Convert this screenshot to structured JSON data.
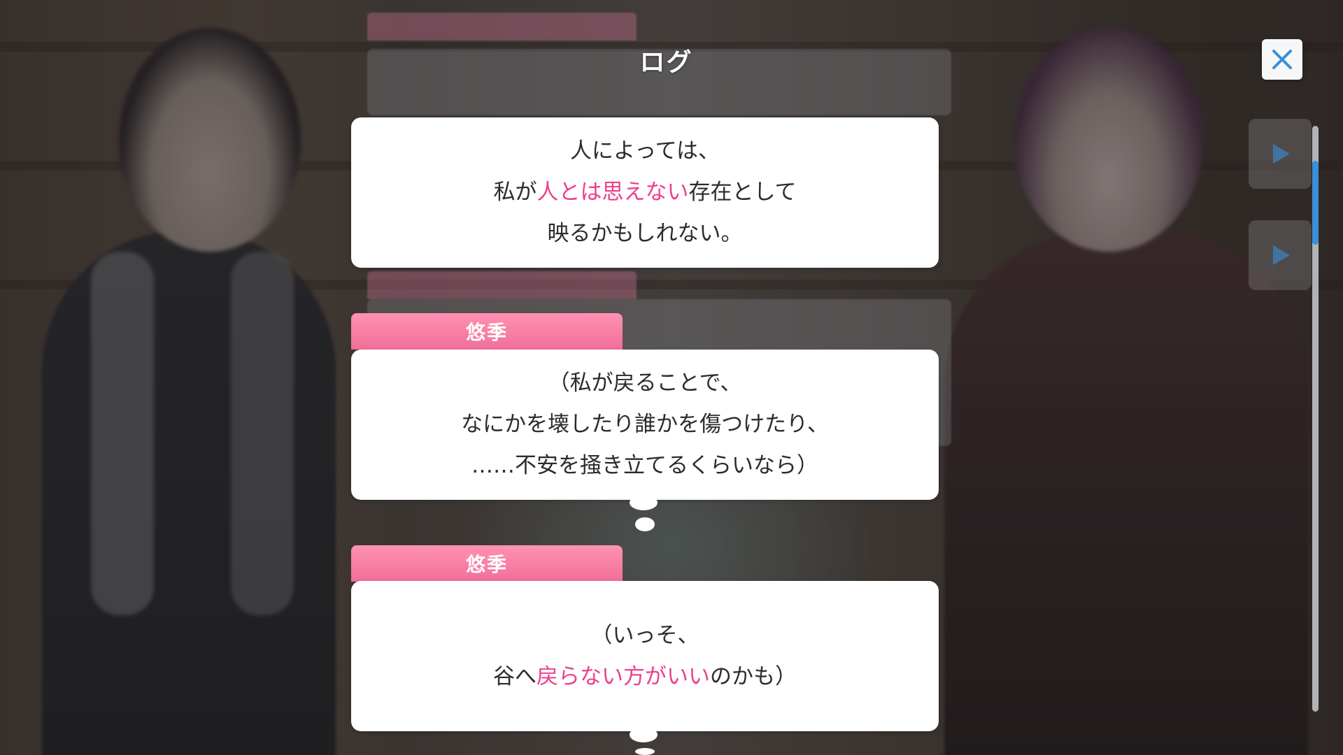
{
  "header": {
    "title": "ログ"
  },
  "controls": {
    "close_icon": "close-icon",
    "voice_icon": "play-icon",
    "accent": "#3a8fd8"
  },
  "log": {
    "entries": [
      {
        "speaker": "",
        "lines": [
          {
            "parts": [
              {
                "text": "人によっては、",
                "hl": false
              }
            ]
          },
          {
            "parts": [
              {
                "text": "私が",
                "hl": false
              },
              {
                "text": "人とは思えない",
                "hl": true
              },
              {
                "text": "存在として",
                "hl": false
              }
            ]
          },
          {
            "parts": [
              {
                "text": "映るかもしれない。",
                "hl": false
              }
            ]
          }
        ]
      },
      {
        "speaker": "悠季",
        "lines": [
          {
            "parts": [
              {
                "text": "（私が戻ることで、",
                "hl": false
              }
            ]
          },
          {
            "parts": [
              {
                "text": "なにかを壊したり誰かを傷つけたり、",
                "hl": false
              }
            ]
          },
          {
            "parts": [
              {
                "text": "……不安を掻き立てるくらいなら）",
                "hl": false
              }
            ]
          }
        ]
      },
      {
        "speaker": "悠季",
        "lines": [
          {
            "parts": [
              {
                "text": "（いっそ、",
                "hl": false
              }
            ]
          },
          {
            "parts": [
              {
                "text": "谷へ",
                "hl": false
              },
              {
                "text": "戻らない方がいい",
                "hl": true
              },
              {
                "text": "のかも）",
                "hl": false
              }
            ]
          }
        ]
      }
    ]
  },
  "colors": {
    "name_tab": "#f06e98",
    "highlight": "#ee3f8d",
    "bubble": "#ffffff",
    "text": "#2e2b2d"
  }
}
